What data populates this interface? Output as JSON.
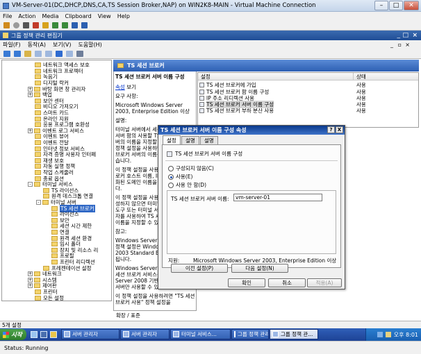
{
  "vm": {
    "title": "VM-Server-01(DC,DHCP,DNS,CA,TS Session Broker,NAP) on WIN2K8-MAIN - Virtual Machine Connection",
    "menu": [
      "File",
      "Action",
      "Media",
      "Clipboard",
      "View",
      "Help"
    ],
    "status": "Status: Running"
  },
  "mmc": {
    "title": "그룹 정책 관리 편집기",
    "menu": [
      "파일(F)",
      "동작(A)",
      "보기(V)",
      "도움말(H)"
    ],
    "status": "5개 설정"
  },
  "tree": [
    {
      "label": "네트워크 액세스 보호",
      "exp": "",
      "sel": false
    },
    {
      "label": "네트워크 프로젝터",
      "exp": "",
      "sel": false
    },
    {
      "label": "녹음기",
      "exp": "",
      "sel": false
    },
    {
      "label": "디지털 락커",
      "exp": "",
      "sel": false
    },
    {
      "label": "바탕 화면 창 관리자",
      "exp": "+",
      "sel": false
    },
    {
      "label": "백업",
      "exp": "+",
      "sel": false
    },
    {
      "label": "보안 센터",
      "exp": "",
      "sel": false
    },
    {
      "label": "비디오 가져오기",
      "exp": "",
      "sel": false
    },
    {
      "label": "스마트 카드",
      "exp": "",
      "sel": false
    },
    {
      "label": "온라인 지원",
      "exp": "",
      "sel": false
    },
    {
      "label": "응용 프로그램 호환성",
      "exp": "",
      "sel": false
    },
    {
      "label": "이벤트 로그 서비스",
      "exp": "+",
      "sel": false
    },
    {
      "label": "이벤트 뷰어",
      "exp": "",
      "sel": false
    },
    {
      "label": "이벤트 전달",
      "exp": "",
      "sel": false
    },
    {
      "label": "인터넷 정보 서비스",
      "exp": "",
      "sel": false
    },
    {
      "label": "자격 증명 사용자 인터페",
      "exp": "",
      "sel": false
    },
    {
      "label": "재생 보호",
      "exp": "",
      "sel": false
    },
    {
      "label": "자동 실행 정책",
      "exp": "",
      "sel": false
    },
    {
      "label": "작업 스케줄러",
      "exp": "",
      "sel": false
    },
    {
      "label": "종료 옵션",
      "exp": "",
      "sel": false
    },
    {
      "label": "터미널 서비스",
      "exp": "-",
      "sel": false
    },
    {
      "label": "TS 라이선스",
      "exp": "",
      "sel": false
    },
    {
      "label": "원격 데스크톱 연결",
      "exp": "",
      "sel": false
    },
    {
      "label": "터미널 서버",
      "exp": "-",
      "sel": false
    },
    {
      "label": "TS 세션 브로커",
      "exp": "",
      "sel": true
    },
    {
      "label": "라이선스",
      "exp": "",
      "sel": false
    },
    {
      "label": "보안",
      "exp": "",
      "sel": false
    },
    {
      "label": "세션 시간 제한",
      "exp": "",
      "sel": false
    },
    {
      "label": "연결",
      "exp": "",
      "sel": false
    },
    {
      "label": "원격 세션 환경",
      "exp": "",
      "sel": false
    },
    {
      "label": "임시 폴더",
      "exp": "",
      "sel": false
    },
    {
      "label": "장치 및 리소스 리",
      "exp": "",
      "sel": false
    },
    {
      "label": "프로필",
      "exp": "",
      "sel": false
    },
    {
      "label": "프린터 리디렉션",
      "exp": "",
      "sel": false
    },
    {
      "label": "프레젠테이션 설정",
      "exp": "",
      "sel": false
    },
    {
      "label": "네트워크",
      "exp": "+",
      "sel": false
    },
    {
      "label": "시스템",
      "exp": "+",
      "sel": false
    },
    {
      "label": "제어판",
      "exp": "+",
      "sel": false
    },
    {
      "label": "프린터",
      "exp": "",
      "sel": false
    },
    {
      "label": "모든 설정",
      "exp": "",
      "sel": false
    }
  ],
  "desc": {
    "header": "TS 세션 브로커",
    "title": "TS 세션 브로커 서버 이름 구성",
    "link_prefix": "속성",
    "link_suffix": " 보기",
    "req_label": "요구 사항:",
    "req_text": "Microsoft Windows Server 2003, Enterprise Edition 이상",
    "p1": "설명:",
    "p2": "터미널 서버에서 세션 브로커 터미널 서버 팜의 사용할 TS 세션 브로커 서버의 이름을 지정할 수 있습니다. 이 정책 설정을 사용하면 서비스 세션 브로커 서버의 이름을 지정할 수 있습니다.",
    "p3": "이 정책 설정을 사용하면 TS 세션 브로커 호스트 이름, IP 주소 또는 정규화된 도메인 이름을 지정해야 합니다.",
    "p4": "이 정책 설정을 사용하지 않거나 구성하지 않으면 터미널 서비스 구성 도구 또는 터미널 서비스 WMI 공급자를 사용하여 TS 세션 브로커 서버 이름을 지정할 수 있습니다.",
    "p5": "참고:",
    "p6": "Windows Server 2003의 경우 이 정책 설정은 Windows Server 2003 Standard Edition에서 지원됩니다.",
    "p7": "Windows Server 2008에서 TS 세션 브로커 서비스는 Windows Server 2008 기반 TS 세션 브로커 서버만 사용할 수 있습니다.",
    "p8": "이 정책 설정을 사용하려면 \"TS 세션 브로커 사용\" 정책 설정을",
    "tabs": "확장 / 표준"
  },
  "list": {
    "col_setting": "설정",
    "col_state": "상태",
    "rows": [
      {
        "name": "TS 세션 브로커에 가입",
        "state": "사용",
        "sel": false
      },
      {
        "name": "TS 세션 브로커 팜 이름 구성",
        "state": "사용",
        "sel": false
      },
      {
        "name": "IP 주소 리디렉션 사용",
        "state": "사용",
        "sel": false
      },
      {
        "name": "TS 세션 브로커 서버 이름 구성",
        "state": "사용",
        "sel": true
      },
      {
        "name": "TS 세션 브로커 부하 분산 사용",
        "state": "사용",
        "sel": false
      }
    ]
  },
  "dialog": {
    "title": "TS 세션 브로커 서버 이름 구성 속성",
    "help": "?",
    "close": "X",
    "tabs": [
      "설정",
      "설명",
      "설명"
    ],
    "setting_name": "TS 세션 브로커 서버 이름 구성",
    "radio_nc": "구성되지 않음(C)",
    "radio_en": "사용(E)",
    "radio_dis": "사용 안 함(D)",
    "field_label": "TS 세션 브로커 서버 이름:",
    "field_value": "vm-server-01",
    "support_label": "지원:",
    "support_value": "Microsoft Windows Server 2003, Enterprise Edition 이상",
    "prev": "이전 설정(P)",
    "next": "다음 설정(N)",
    "ok": "확인",
    "cancel": "취소",
    "apply": "적용(A)"
  },
  "taskbar": {
    "start": "시작",
    "items": [
      {
        "label": "서버 관리자",
        "active": false
      },
      {
        "label": "서버 관리자",
        "active": false
      },
      {
        "label": "터미널 서비스...",
        "active": false
      },
      {
        "label": "그룹 정책 관리",
        "active": false
      },
      {
        "label": "그룹 정책 관...",
        "active": true
      }
    ],
    "clock": "오후 8:01"
  }
}
